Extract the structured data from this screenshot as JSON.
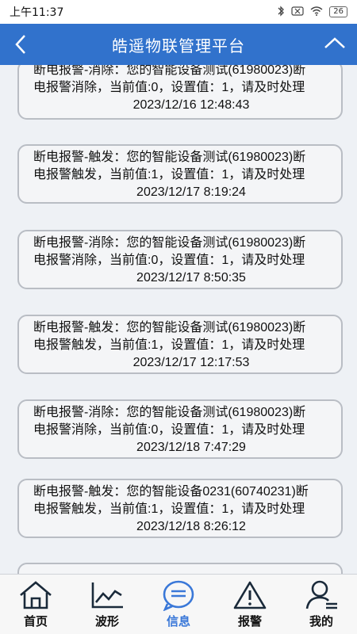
{
  "status_bar": {
    "time": "上午11:37",
    "battery": "26"
  },
  "header": {
    "title": "皓遥物联管理平台"
  },
  "messages": [
    {
      "line1": "断电报警-消除：您的智能设备测试(61980023)断",
      "line2": "电报警消除，当前值:0，设置值：1，请及时处理",
      "time": "2023/12/16 12:48:43"
    },
    {
      "line1": "断电报警-触发：您的智能设备测试(61980023)断",
      "line2": "电报警触发，当前值:1，设置值：1，请及时处理",
      "time": "2023/12/17 8:19:24"
    },
    {
      "line1": "断电报警-消除：您的智能设备测试(61980023)断",
      "line2": "电报警消除，当前值:0，设置值：1，请及时处理",
      "time": "2023/12/17 8:50:35"
    },
    {
      "line1": "断电报警-触发：您的智能设备测试(61980023)断",
      "line2": "电报警触发，当前值:1，设置值：1，请及时处理",
      "time": "2023/12/17 12:17:53"
    },
    {
      "line1": "断电报警-消除：您的智能设备测试(61980023)断",
      "line2": "电报警消除，当前值:0，设置值：1，请及时处理",
      "time": "2023/12/18 7:47:29"
    },
    {
      "line1": "断电报警-触发：您的智能设备0231(60740231)断",
      "line2": "电报警触发，当前值:1，设置值：1，请及时处理",
      "time": "2023/12/18 8:26:12"
    }
  ],
  "tabs": [
    {
      "label": "首页",
      "icon": "home-icon"
    },
    {
      "label": "波形",
      "icon": "chart-icon"
    },
    {
      "label": "信息",
      "icon": "message-icon"
    },
    {
      "label": "报警",
      "icon": "warning-icon"
    },
    {
      "label": "我的",
      "icon": "user-icon"
    }
  ],
  "colors": {
    "header": "#3172cc",
    "active_tab": "#3a78d8"
  }
}
